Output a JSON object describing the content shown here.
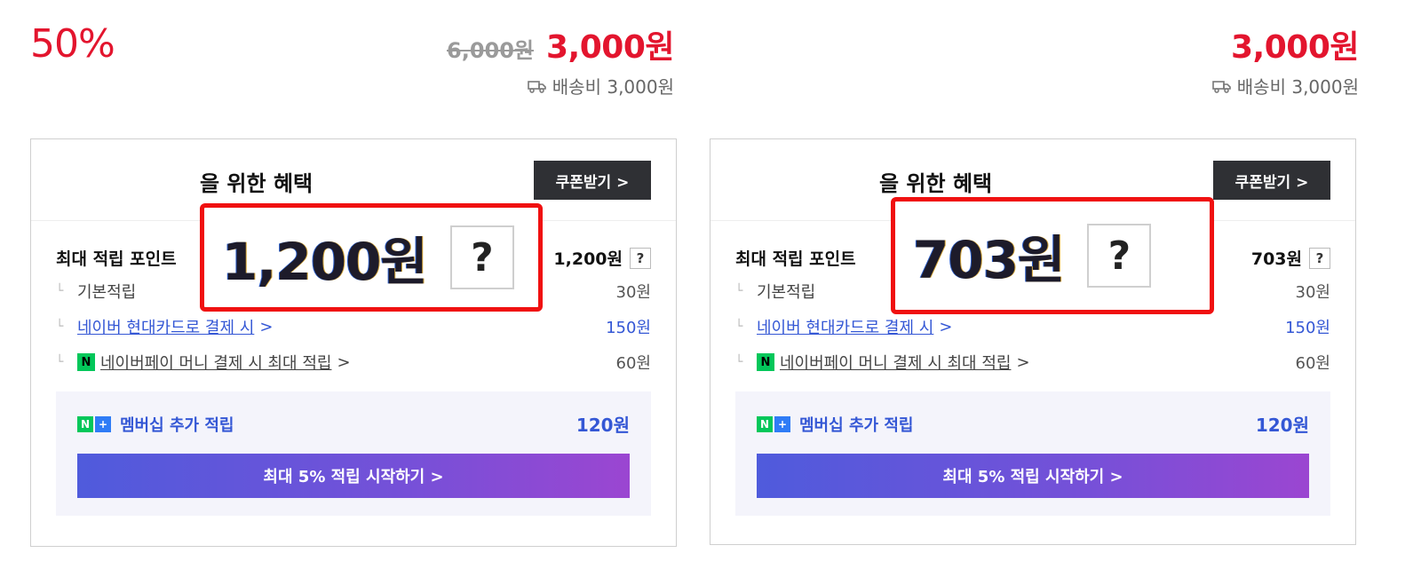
{
  "left": {
    "discount": "50%",
    "old_price": "6,000원",
    "new_price": "3,000원",
    "shipping": "배송비 3,000원",
    "card": {
      "title": "을 위한 혜택",
      "coupon_button": "쿠폰받기 >",
      "max_points_label": "최대 적립 포인트",
      "max_points_value": "1,200원",
      "q_small": "?",
      "basic_label": "기본적립",
      "basic_value": "30원",
      "hyundai_label": "네이버 현대카드로 결제 시",
      "hyundai_arrow": ">",
      "hyundai_value": "150원",
      "npay_badge": "N",
      "npay_label": "네이버페이 머니 결제 시 최대 적립",
      "npay_arrow": ">",
      "npay_value": "60원",
      "member_label": "멤버십 추가 적립",
      "member_value": "120원",
      "nplus_n": "N",
      "nplus_p": "+",
      "start_button": "최대 5% 적립 시작하기 >"
    },
    "callout": {
      "amount": "1,200원",
      "q": "?"
    }
  },
  "right": {
    "new_price": "3,000원",
    "shipping": "배송비 3,000원",
    "card": {
      "title": "을 위한 혜택",
      "coupon_button": "쿠폰받기 >",
      "max_points_label": "최대 적립 포인트",
      "max_points_value": "703원",
      "q_small": "?",
      "basic_label": "기본적립",
      "basic_value": "30원",
      "hyundai_label": "네이버 현대카드로 결제 시",
      "hyundai_arrow": ">",
      "hyundai_value": "150원",
      "npay_badge": "N",
      "npay_label": "네이버페이 머니 결제 시 최대 적립",
      "npay_arrow": ">",
      "npay_value": "60원",
      "member_label": "멤버십 추가 적립",
      "member_value": "120원",
      "nplus_n": "N",
      "nplus_p": "+",
      "start_button": "최대 5% 적립 시작하기 >"
    },
    "callout": {
      "amount": "703원",
      "q": "?"
    }
  },
  "colors": {
    "discount_red": "#e3152e",
    "callout_border": "#f01010",
    "link_blue": "#3457d5",
    "npay_green": "#03c75a",
    "button_dark": "#2f3034"
  },
  "icons": {
    "shipping": "truck-icon",
    "tree": "tree-branch-icon"
  }
}
